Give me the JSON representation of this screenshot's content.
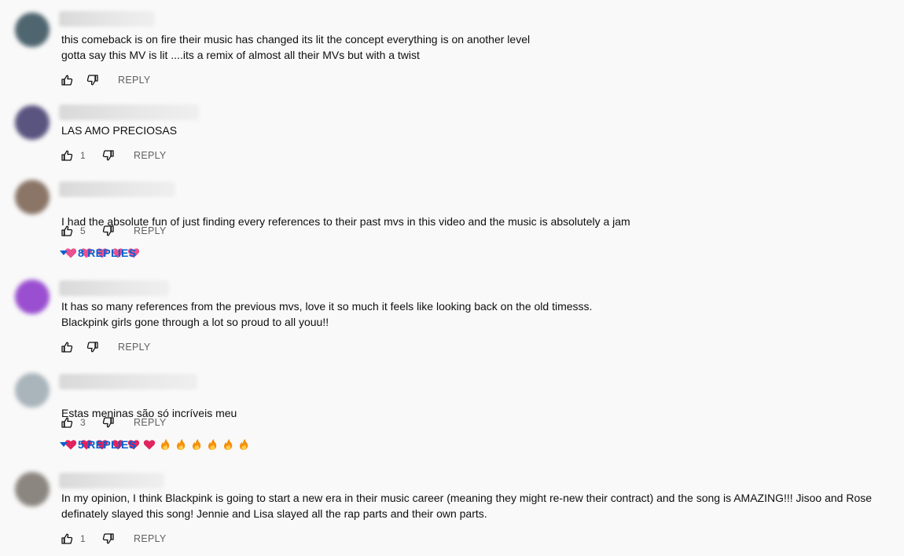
{
  "colors": {
    "background": "#f9f9f9",
    "text": "#0f0f0f",
    "muted": "#606060",
    "link": "#065fd4"
  },
  "comments": [
    {
      "text": "this comeback is on fire their music has changed its lit the concept everything is on another level\ngotta say this MV is lit ....its a remix of almost all their MVs but with a twist",
      "likes": "",
      "reply_label": "REPLY",
      "avatar_color": "#4f6670"
    },
    {
      "text": "LAS AMO PRECIOSAS",
      "likes": "1",
      "reply_label": "REPLY",
      "avatar_color": "#5a5480"
    },
    {
      "text": "I had the absolute fun of just finding every references to their past mvs in this video and the music is absolutely a jam",
      "emojis": [
        "pink-heart-icon",
        "pink-heart-icon",
        "pink-heart-icon",
        "pink-heart-icon",
        "pink-heart-icon"
      ],
      "likes": "5",
      "reply_label": "REPLY",
      "replies_label": "8 REPLIES",
      "avatar_color": "#8a7566"
    },
    {
      "text": "It has so many references from the previous mvs, love it so much it feels like looking back on the old timesss.\nBlackpink girls gone through a lot so proud  to all youu!!",
      "likes": "",
      "reply_label": "REPLY",
      "avatar_color": "#9a4fd0"
    },
    {
      "text": "Estas meninas são só incríveis meu",
      "emojis": [
        "red-heart-icon",
        "red-heart-icon",
        "red-heart-icon",
        "red-heart-icon",
        "red-heart-icon",
        "red-heart-icon",
        "fire-icon",
        "fire-icon",
        "fire-icon",
        "fire-icon",
        "fire-icon",
        "fire-icon"
      ],
      "likes": "3",
      "reply_label": "REPLY",
      "replies_label": "5 REPLIES",
      "avatar_color": "#a9b4bb"
    },
    {
      "text": "In my opinion, I think Blackpink is going to start a new era in their music career (meaning they might re-new their contract) and the song is AMAZING!!! Jisoo and Rose\ndefinately slayed this song! Jennie and Lisa slayed all the rap parts and their own parts.",
      "likes": "1",
      "reply_label": "REPLY",
      "avatar_color": "#8c8680"
    }
  ]
}
